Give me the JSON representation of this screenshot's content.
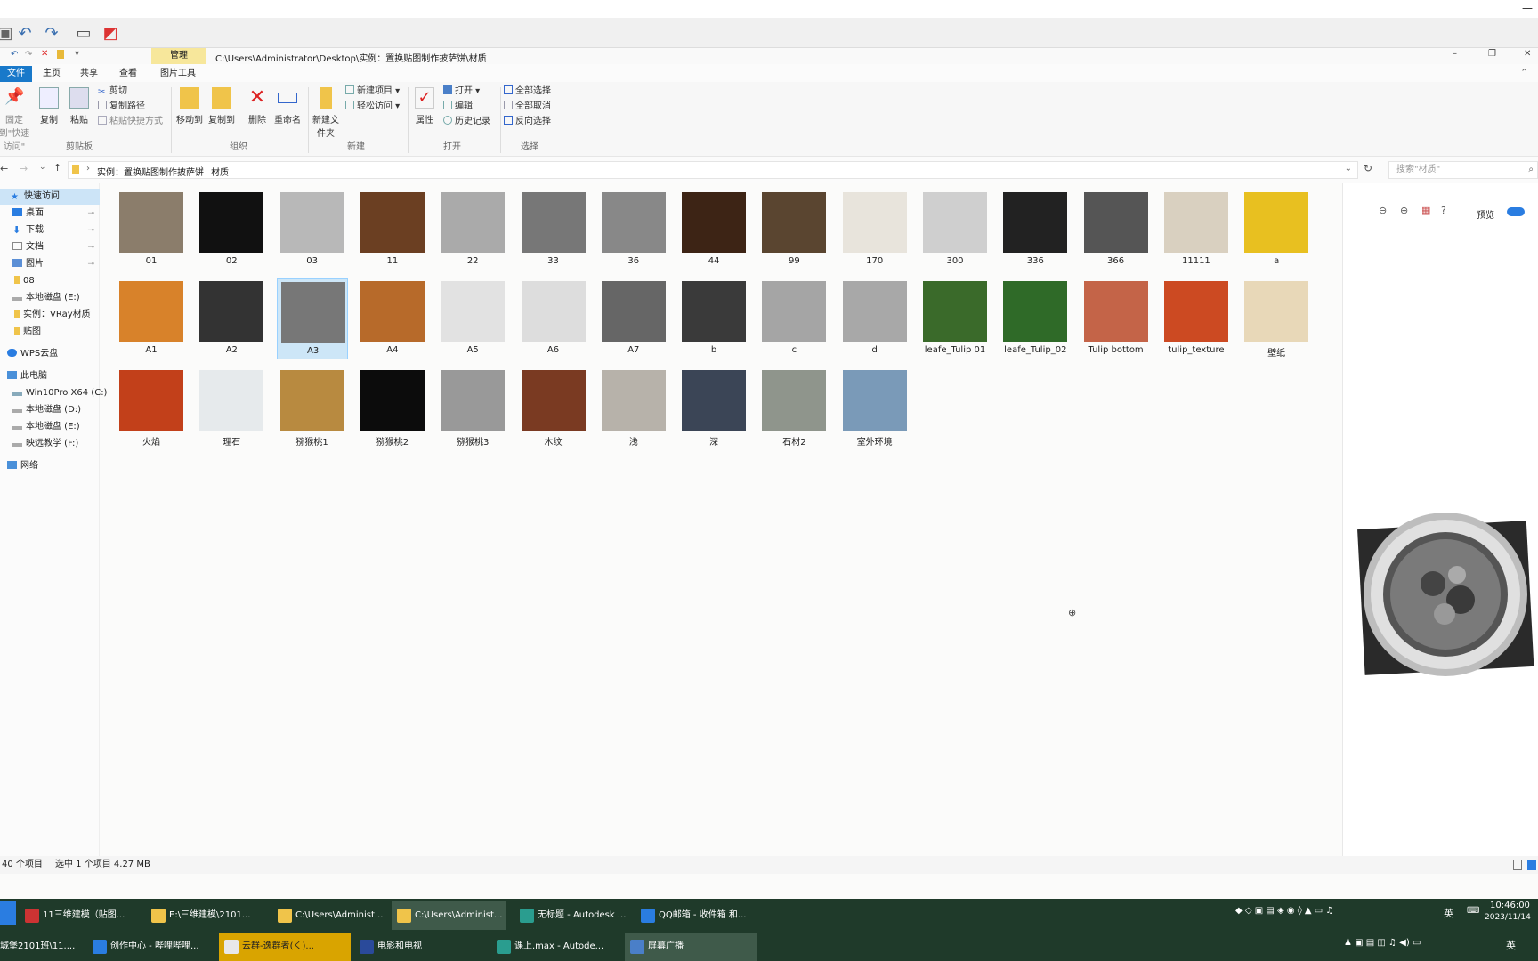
{
  "window": {
    "path": "C:\\Users\\Administrator\\Desktop\\实例：置换贴图制作披萨饼\\材质",
    "manage_tab": "管理",
    "picture_tools_tab": "图片工具"
  },
  "tabs": {
    "file": "文件",
    "home": "主页",
    "share": "共享",
    "view": "查看"
  },
  "ribbon": {
    "pin": "固定到\"快速访问\"",
    "copy": "复制",
    "paste": "粘贴",
    "cut": "剪切",
    "copy_path": "复制路径",
    "paste_shortcut": "粘贴快捷方式",
    "clipboard": "剪贴板",
    "move_to": "移动到",
    "copy_to": "复制到",
    "delete": "删除",
    "rename": "重命名",
    "organize": "组织",
    "new_folder": "新建文件夹",
    "new_item": "新建项目",
    "easy_access": "轻松访问",
    "new": "新建",
    "properties": "属性",
    "open": "打开",
    "edit": "编辑",
    "history": "历史记录",
    "open_group": "打开",
    "select_all": "全部选择",
    "select_none": "全部取消",
    "invert": "反向选择",
    "select_group": "选择"
  },
  "address": {
    "crumb1": "实例：置换贴图制作披萨饼",
    "crumb2": "材质",
    "search_placeholder": "搜索\"材质\""
  },
  "nav": {
    "quick_access": "快速访问",
    "desktop": "桌面",
    "downloads": "下载",
    "documents": "文档",
    "pictures": "图片",
    "f08": "08",
    "local_e1": "本地磁盘 (E:)",
    "vray": "实例：VRay材质",
    "maps": "贴图",
    "wps": "WPS云盘",
    "this_pc": "此电脑",
    "c": "Win10Pro X64 (C:)",
    "d": "本地磁盘 (D:)",
    "e": "本地磁盘 (E:)",
    "f": "映远教学 (F:)",
    "network": "网络"
  },
  "files": [
    "01",
    "02",
    "03",
    "11",
    "22",
    "33",
    "36",
    "44",
    "99",
    "170",
    "300",
    "336",
    "366",
    "11111",
    "a",
    "A1",
    "A2",
    "A3",
    "A4",
    "A5",
    "A6",
    "A7",
    "b",
    "c",
    "d",
    "leafe_Tulip 01",
    "leafe_Tulip_02",
    "Tulip bottom",
    "tulip_texture",
    "壁纸",
    "火焰",
    "理石",
    "猕猴桃1",
    "猕猴桃2",
    "猕猴桃3",
    "木纹",
    "浅",
    "深",
    "石材2",
    "室外环境"
  ],
  "preview": {
    "toggle_label": "预览"
  },
  "status": {
    "count": "40 个项目",
    "selected": "选中 1 个项目  4.27 MB"
  },
  "taskbar": {
    "row1": [
      "11三维建模（贴图...",
      "E:\\三维建模\\2101...",
      "C:\\Users\\Administ...",
      "C:\\Users\\Administ...",
      "无标题 - Autodesk ...",
      "QQ邮箱 - 收件箱 和..."
    ],
    "row2": [
      "城堡2101班\\11....",
      "创作中心 - 哔哩哔哩...",
      "云群-逸群者(く)...",
      "电影和电视",
      "课上.max - Autode...",
      "屏幕广播"
    ],
    "time": "10:46:00",
    "date": "2023/11/14",
    "ime": "英"
  }
}
